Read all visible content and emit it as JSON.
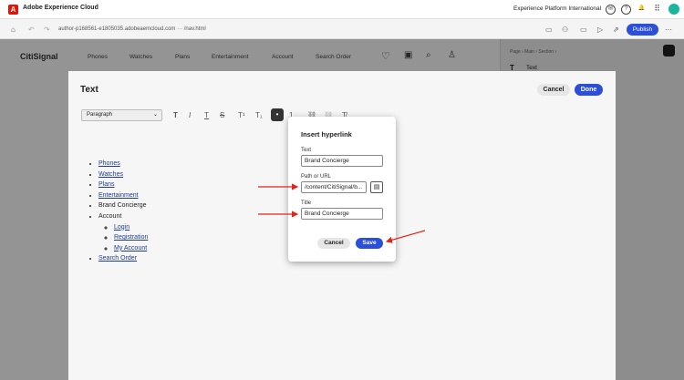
{
  "topbar": {
    "logo": "A",
    "app_title": "Adobe Experience Cloud",
    "org": "Experience Platform International",
    "icons": [
      "chat-icon",
      "help-icon",
      "bell-icon",
      "apps-grid-icon"
    ]
  },
  "toolbar": {
    "url": "author-p168561-e1805035.adobeaemcloud.com  ···  /nav.html",
    "publish": "Publish"
  },
  "site": {
    "logo": "CitiSignal",
    "nav": [
      "Phones",
      "Watches",
      "Plans",
      "Entertainment",
      "Account",
      "Search Order"
    ]
  },
  "right_panel": {
    "breadcrumb": "Page  ›  Main  ›  Section  ›",
    "component": "Text"
  },
  "editor": {
    "title": "Text",
    "cancel": "Cancel",
    "done": "Done",
    "paragraph": "Paragraph",
    "format_icons": [
      "T",
      "I",
      "T",
      "S",
      "T¹",
      "T₁",
      "•",
      "1.",
      "⛓",
      "⛓",
      "T̸"
    ]
  },
  "content": {
    "items": [
      "Phones",
      "Watches",
      "Plans",
      "Entertainment",
      "Brand Concierge",
      "Account",
      "Search Order"
    ],
    "account_children": [
      "Login",
      "Registration",
      "My Account"
    ]
  },
  "dialog": {
    "title": "Insert hyperlink",
    "text_label": "Text",
    "text_value": "Brand Concierge",
    "path_label": "Path or URL",
    "path_value": "/content/CitiSignal/b...",
    "title_label": "Title",
    "title_value": "Brand Concierge",
    "cancel": "Cancel",
    "save": "Save"
  },
  "colors": {
    "accent": "#2b4fd9",
    "annotation": "#e0261b"
  }
}
